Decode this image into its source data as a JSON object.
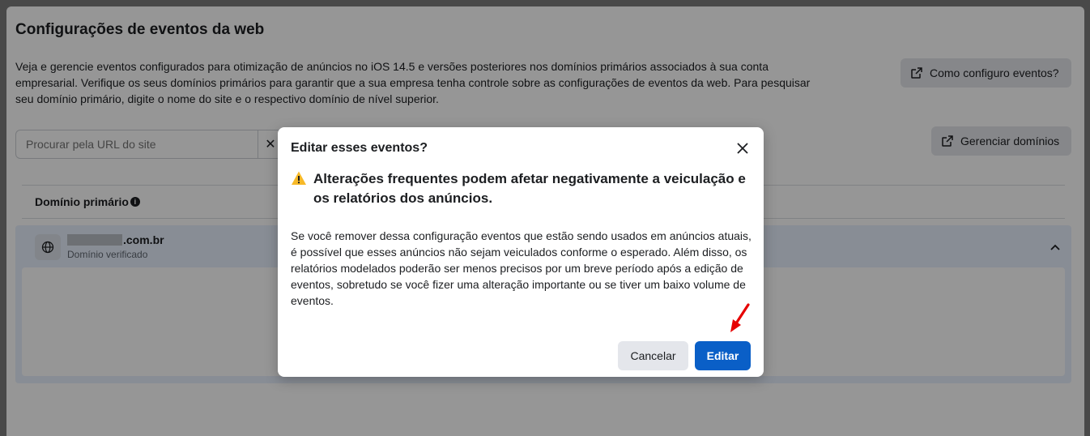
{
  "page": {
    "title": "Configurações de eventos da web",
    "description": "Veja e gerencie eventos configurados para otimização de anúncios no iOS 14.5 e versões posteriores nos domínios primários associados à sua conta empresarial. Verifique os seus domínios primários para garantir que a sua empresa tenha controle sobre as configurações de eventos da web. Para pesquisar seu domínio primário, digite o nome do site e o respectivo domínio de nível superior.",
    "how_button": "Como configuro eventos?",
    "manage_domains_button": "Gerenciar domínios",
    "search_placeholder": "Procurar pela URL do site",
    "column_header": "Domínio primário",
    "domain": {
      "name_suffix": ".com.br",
      "status": "Domínio verificado"
    }
  },
  "modal": {
    "title": "Editar esses eventos?",
    "warning_heading": "Alterações frequentes podem afetar negativamente a veiculação e os relatórios dos anúncios.",
    "body": "Se você remover dessa configuração eventos que estão sendo usados em anúncios atuais, é possível que esses anúncios não sejam veiculados conforme o esperado. Além disso, os relatórios modelados poderão ser menos precisos por um breve período após a edição de eventos, sobretudo se você fizer uma alteração importante ou se tiver um baixo volume de eventos.",
    "cancel_label": "Cancelar",
    "edit_label": "Editar"
  },
  "colors": {
    "primary": "#0a5fc7",
    "warning": "#f7b928",
    "annotation_arrow": "#e60000"
  },
  "icons": [
    "external-link-icon",
    "clear-icon",
    "info-icon",
    "globe-icon",
    "chevron-up-icon",
    "close-icon",
    "warning-icon",
    "red-arrow-annotation"
  ]
}
